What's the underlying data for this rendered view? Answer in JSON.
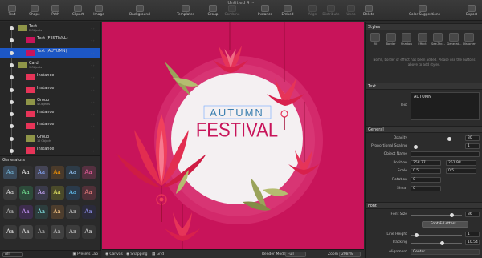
{
  "window": {
    "title": "Untitled 4 ~"
  },
  "toolbar": [
    {
      "label": "Text",
      "icon": "text-icon",
      "enabled": true
    },
    {
      "label": "Shape",
      "icon": "shape-icon",
      "enabled": true
    },
    {
      "label": "Path",
      "icon": "path-icon",
      "enabled": true
    },
    {
      "label": "Clipart",
      "icon": "clipart-icon",
      "enabled": true
    },
    {
      "label": "Image",
      "icon": "image-icon",
      "enabled": true
    },
    {
      "label": "Background",
      "icon": "background-icon",
      "enabled": true
    },
    {
      "label": "Templates",
      "icon": "templates-icon",
      "enabled": true
    },
    {
      "label": "Group",
      "icon": "group-icon",
      "enabled": true
    },
    {
      "label": "Combine",
      "icon": "combine-icon",
      "enabled": false
    },
    {
      "label": "Instance",
      "icon": "instance-icon",
      "enabled": true
    },
    {
      "label": "Embed",
      "icon": "embed-icon",
      "enabled": true
    },
    {
      "label": "Align",
      "icon": "align-icon",
      "enabled": false
    },
    {
      "label": "Distribute",
      "icon": "distribute-icon",
      "enabled": false
    },
    {
      "label": "Undo",
      "icon": "undo-icon",
      "enabled": false
    },
    {
      "label": "Delete",
      "icon": "delete-icon",
      "enabled": true
    },
    {
      "label": "Color Suggestions",
      "icon": "color-suggestions-icon",
      "enabled": true
    },
    {
      "label": "Export",
      "icon": "export-icon",
      "enabled": true
    }
  ],
  "layers": [
    {
      "name": "Text",
      "sub": "2 Objects",
      "kind": "group",
      "selected": false
    },
    {
      "name": "Text (FESTIVAL)",
      "sub": "",
      "kind": "text",
      "selected": false
    },
    {
      "name": "Text (AUTUMN)",
      "sub": "",
      "kind": "text",
      "selected": true
    },
    {
      "name": "Card",
      "sub": "9 Objects",
      "kind": "group",
      "selected": false
    },
    {
      "name": "Instance",
      "sub": "",
      "kind": "instance",
      "selected": false
    },
    {
      "name": "Instance",
      "sub": "",
      "kind": "instance",
      "selected": false
    },
    {
      "name": "Group",
      "sub": "4 Objects",
      "kind": "group",
      "selected": false
    },
    {
      "name": "Instance",
      "sub": "",
      "kind": "instance",
      "selected": false
    },
    {
      "name": "Instance",
      "sub": "",
      "kind": "instance",
      "selected": false
    },
    {
      "name": "Group",
      "sub": "10 Objects",
      "kind": "group",
      "selected": false
    },
    {
      "name": "Instance",
      "sub": "",
      "kind": "instance",
      "selected": false
    }
  ],
  "generators": {
    "title": "Generators",
    "filter": "All",
    "presets_label": "Presets Lab",
    "cells": [
      "Aa",
      "Aa",
      "Aa",
      "Aa",
      "Aa",
      "Aa",
      "Aa",
      "Aa",
      "Aa",
      "Aa",
      "Aa",
      "Aa",
      "Aa",
      "Aa",
      "Aa",
      "Aa",
      "Aa",
      "Aa",
      "Aa",
      "Aa",
      "Aa",
      "Aa",
      "Aa",
      "Aa"
    ]
  },
  "canvas": {
    "autumn_text": "AUTUMN",
    "festival_text": "FESTIVAL",
    "bg_color": "#c8145a",
    "circle_color": "#f4f0f2",
    "lotus_color": "#f0405c",
    "leaf_color": "#9aa35a"
  },
  "bottombar": {
    "canvas_label": "Canvas",
    "snapping_label": "Snapping",
    "grid_label": "Grid",
    "render_mode_label": "Render Mode",
    "render_mode_value": "Full",
    "zoom_label": "Zoom",
    "zoom_value": "208 %"
  },
  "inspector": {
    "styles": {
      "title": "Styles",
      "buttons": [
        {
          "label": "Fill",
          "icon": "fill-icon"
        },
        {
          "label": "Border",
          "icon": "border-icon"
        },
        {
          "label": "Shadow",
          "icon": "shadow-icon"
        },
        {
          "label": "Effect",
          "icon": "effect-icon"
        },
        {
          "label": "See-Thr...",
          "icon": "see-through-icon"
        },
        {
          "label": "Generat...",
          "icon": "generator-icon"
        },
        {
          "label": "Distorter",
          "icon": "distorter-icon"
        }
      ],
      "note": "No fill, border or effect has been added. Please use the buttons above to add styles."
    },
    "text": {
      "title": "Text",
      "label": "Text",
      "value": "AUTUMN"
    },
    "general": {
      "title": "General",
      "opacity_label": "Opacity",
      "opacity_value": "30",
      "opacity_frac": 0.75,
      "scaling_label": "Proportional Scaling",
      "scaling_value": "1",
      "scaling_frac": 0.1,
      "object_name_label": "Object Name",
      "position_label": "Position",
      "position_x": "258.77",
      "position_y": "251.98",
      "scale_label": "Scale",
      "scale_x": "0.5",
      "scale_y": "0.5",
      "rotation_label": "Rotation",
      "rotation_value": "0",
      "shear_label": "Shear",
      "shear_value": "0"
    },
    "font": {
      "title": "Font",
      "size_label": "Font Size",
      "size_value": "36",
      "size_frac": 0.8,
      "button_label": "Font & Letters...",
      "line_height_label": "Line Height",
      "line_height_value": "1",
      "line_height_frac": 0.12,
      "tracking_label": "Tracking",
      "tracking_value": "10.54",
      "tracking_frac": 0.62,
      "alignment_label": "Alignment",
      "alignment_value": "Center"
    }
  }
}
